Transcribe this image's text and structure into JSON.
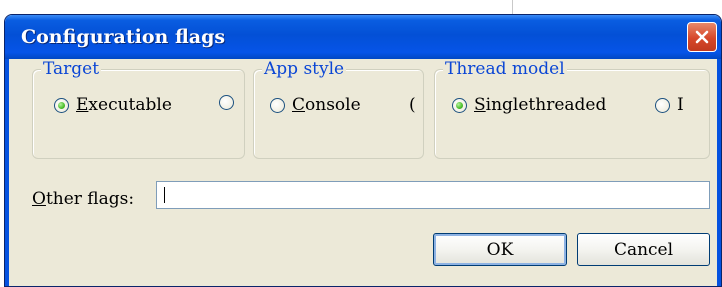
{
  "dialog": {
    "title": "Configuration flags"
  },
  "groups": {
    "target": {
      "label": "Target",
      "options": [
        {
          "accel": "E",
          "rest": "xecutable",
          "checked": true
        },
        {
          "accel": "",
          "rest": "",
          "checked": false
        }
      ]
    },
    "app_style": {
      "label": "App style",
      "options": [
        {
          "accel": "C",
          "rest": "onsole",
          "checked": false
        }
      ]
    },
    "thread_model": {
      "label": "Thread model",
      "options": [
        {
          "accel": "S",
          "rest": "inglethreaded",
          "checked": true
        },
        {
          "accel": "",
          "rest": "",
          "checked": false
        }
      ]
    }
  },
  "other_flags": {
    "label_accel": "O",
    "label_rest": "ther flags:",
    "value": ""
  },
  "buttons": {
    "ok": "OK",
    "cancel": "Cancel"
  },
  "colors": {
    "titlebar": "#0350d6",
    "group_label": "#0b46d5",
    "dialog_bg": "#ece9d8",
    "close_button": "#d6472a"
  }
}
